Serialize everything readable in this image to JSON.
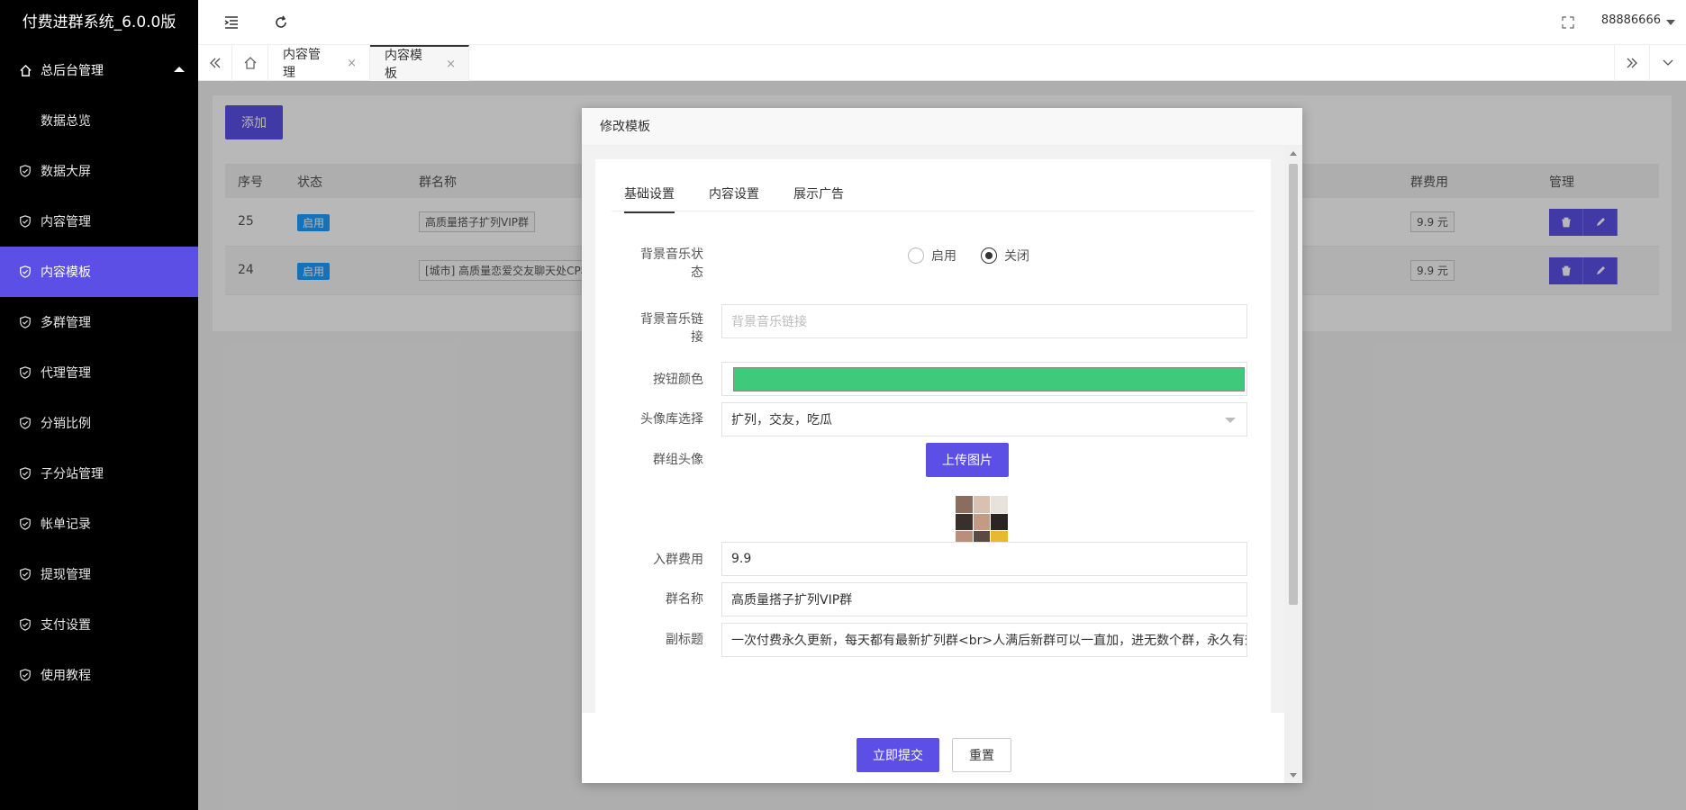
{
  "app": {
    "title": "付费进群系统_6.0.0版"
  },
  "sidebar": {
    "items": [
      {
        "label": "总后台管理",
        "icon": "home-icon"
      },
      {
        "label": "数据总览"
      },
      {
        "label": "数据大屏",
        "icon": "shield-check-icon"
      },
      {
        "label": "内容管理",
        "icon": "shield-check-icon"
      },
      {
        "label": "内容模板",
        "icon": "shield-check-icon",
        "active": true
      },
      {
        "label": "多群管理",
        "icon": "shield-check-icon"
      },
      {
        "label": "代理管理",
        "icon": "shield-check-icon"
      },
      {
        "label": "分销比例",
        "icon": "shield-check-icon"
      },
      {
        "label": "子分站管理",
        "icon": "shield-check-icon"
      },
      {
        "label": "帐单记录",
        "icon": "shield-check-icon"
      },
      {
        "label": "提现管理",
        "icon": "shield-check-icon"
      },
      {
        "label": "支付设置",
        "icon": "shield-check-icon"
      },
      {
        "label": "使用教程",
        "icon": "shield-check-icon"
      }
    ]
  },
  "header": {
    "username": "88886666"
  },
  "tabs": [
    {
      "label": "内容管理",
      "close": "×"
    },
    {
      "label": "内容模板",
      "close": "×"
    }
  ],
  "toolbar": {
    "add_label": "添加"
  },
  "table": {
    "headers": [
      "序号",
      "状态",
      "群名称",
      "群费用",
      "管理"
    ],
    "rows": [
      {
        "id": "25",
        "status": "启用",
        "name": "高质量搭子扩列VIP群",
        "fee": "9.9 元"
      },
      {
        "id": "24",
        "status": "启用",
        "name": "[城市] 高质量恋爱交友聊天处CP群",
        "fee": "9.9 元"
      }
    ]
  },
  "modal": {
    "title": "修改模板",
    "tabs": [
      "基础设置",
      "内容设置",
      "展示广告"
    ],
    "fields": {
      "music_status": {
        "label1": "背景音乐状",
        "label2": "态",
        "options": [
          "启用",
          "关闭"
        ],
        "selected": "关闭"
      },
      "music_link": {
        "label1": "背景音乐链",
        "label2": "接",
        "placeholder": "背景音乐链接"
      },
      "button_color": {
        "label": "按钮颜色",
        "value": "#3fc97a"
      },
      "avatar_lib": {
        "label": "头像库选择",
        "value": "扩列，交友，吃瓜"
      },
      "group_avatar": {
        "label": "群组头像",
        "upload_label": "上传图片"
      },
      "fee": {
        "label": "入群费用",
        "value": "9.9"
      },
      "group_name": {
        "label": "群名称",
        "value": "高质量搭子扩列VIP群"
      },
      "subtitle": {
        "label": "副标题",
        "value": "一次付费永久更新，每天都有最新扩列群<br>人满后新群可以一直加，进无数个群，永久有效"
      }
    },
    "submit_label": "立即提交",
    "reset_label": "重置"
  },
  "colors": {
    "accent": "#5b4fe6",
    "badge": "#1e9fff",
    "swatch": "#3fc97a"
  }
}
